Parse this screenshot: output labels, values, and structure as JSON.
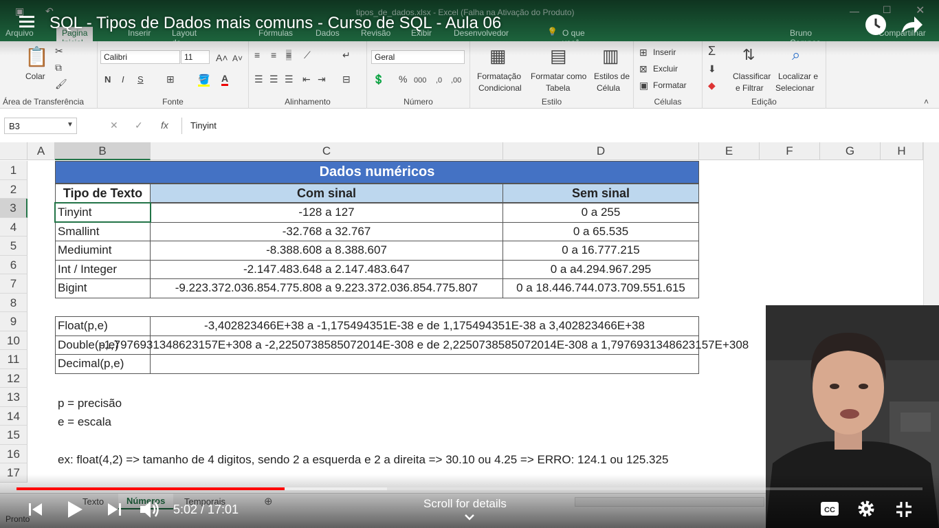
{
  "window": {
    "file_title": "tipos_de_dados.xlsx - Excel (Falha na Ativação do Produto)",
    "user": "Bruno Campos",
    "share": "Compartilhar",
    "tell_me": "O que você deseja fazer...",
    "tabs": [
      "Arquivo",
      "Página Inicial",
      "Inserir",
      "Layout da Página",
      "Fórmulas",
      "Dados",
      "Revisão",
      "Exibir",
      "Desenvolvedor"
    ]
  },
  "ribbon": {
    "paste": "Colar",
    "clipboard_group": "Área de Transferência",
    "font_name": "Calibri",
    "font_size": "11",
    "font_group": "Fonte",
    "bold": "N",
    "italic": "I",
    "underline": "S",
    "align_group": "Alinhamento",
    "number_format": "Geral",
    "number_group": "Número",
    "cond_format": [
      "Formatação",
      "Condicional"
    ],
    "format_table": [
      "Formatar como",
      "Tabela"
    ],
    "cell_styles": [
      "Estilos de",
      "Célula"
    ],
    "style_group": "Estilo",
    "insert": "Inserir",
    "delete": "Excluir",
    "format": "Formatar",
    "cells_group": "Células",
    "sort_filter": [
      "Classificar",
      "e Filtrar"
    ],
    "find_select": [
      "Localizar e",
      "Selecionar"
    ],
    "edit_group": "Edição"
  },
  "formula_bar": {
    "name_box": "B3",
    "fx": "fx",
    "value": "Tinyint"
  },
  "sheet": {
    "columns": [
      "A",
      "B",
      "C",
      "D",
      "E",
      "F",
      "G",
      "H"
    ],
    "rows": [
      "1",
      "2",
      "3",
      "4",
      "5",
      "6",
      "7",
      "8",
      "9",
      "10",
      "11",
      "12",
      "13",
      "14",
      "15",
      "16",
      "17"
    ],
    "title": "Dados numéricos",
    "headers": [
      "Tipo de Texto",
      "Com sinal",
      "Sem sinal"
    ],
    "int_types": [
      {
        "type": "Tinyint",
        "signed": "-128 a 127",
        "unsigned": "0 a 255"
      },
      {
        "type": "Smallint",
        "signed": "-32.768 a 32.767",
        "unsigned": "0 a 65.535"
      },
      {
        "type": "Mediumint",
        "signed": "-8.388.608 a 8.388.607",
        "unsigned": "0 a 16.777.215"
      },
      {
        "type": "Int / Integer",
        "signed": "-2.147.483.648 a 2.147.483.647",
        "unsigned": "0 a a4.294.967.295"
      },
      {
        "type": "Bigint",
        "signed": "-9.223.372.036.854.775.808 a 9.223.372.036.854.775.807",
        "unsigned": "0 a 18.446.744.073.709.551.615"
      }
    ],
    "float_types": [
      {
        "type": "Float(p,e)",
        "range": "-3,402823466E+38 a -1,175494351E-38 e de 1,175494351E-38 a 3,402823466E+38"
      },
      {
        "type": "Double(p,e)",
        "range": "-1,7976931348623157E+308 a -2,2250738585072014E-308 e de 2,2250738585072014E-308 a 1,7976931348623157E+308"
      },
      {
        "type": "Decimal(p,e)",
        "range": ""
      }
    ],
    "note_p": "p = precisão",
    "note_e": "e = escala",
    "example": "ex: float(4,2) => tamanho de 4 digitos, sendo 2 a esquerda e 2 a direita => 30.10 ou 4.25 => ERRO: 124.1 ou 125.325",
    "sheet_tabs": [
      "Texto",
      "Números",
      "Temporais"
    ],
    "status": "Pronto"
  },
  "player": {
    "video_title": "SQL - Tipos de Dados mais comuns - Curso de SQL - Aula 06",
    "time": "5:02 / 17:01",
    "scroll_hint": "Scroll for details",
    "progress_played": 0.296,
    "progress_buffered": 0.409,
    "accent": "#ff0000"
  }
}
